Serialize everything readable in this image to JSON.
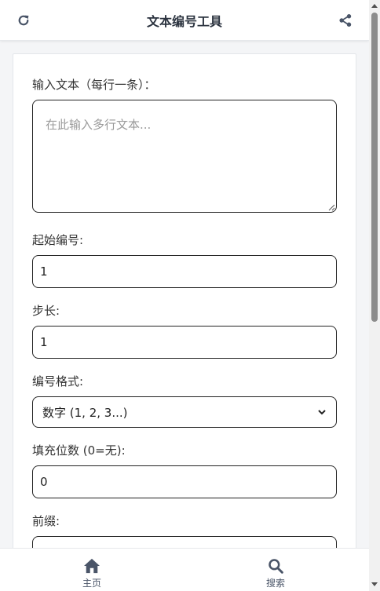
{
  "header": {
    "title": "文本编号工具",
    "left_icon": "refresh-icon",
    "right_icon": "share-icon"
  },
  "form": {
    "text_input": {
      "label": "输入文本（每行一条）：",
      "placeholder": "在此输入多行文本...",
      "value": ""
    },
    "start_number": {
      "label": "起始编号:",
      "value": "1"
    },
    "step": {
      "label": "步长:",
      "value": "1"
    },
    "format": {
      "label": "编号格式:",
      "selected": "数字 (1, 2, 3...)"
    },
    "padding": {
      "label": "填充位数 (0=无):",
      "value": "0"
    },
    "prefix": {
      "label": "前缀:",
      "value": ""
    }
  },
  "bottom_nav": {
    "items": [
      {
        "label": "主页",
        "icon": "home-icon"
      },
      {
        "label": "搜索",
        "icon": "search-icon"
      }
    ]
  },
  "colors": {
    "icon": "#4a5568",
    "border": "#222222",
    "background": "#f4f5f7"
  }
}
